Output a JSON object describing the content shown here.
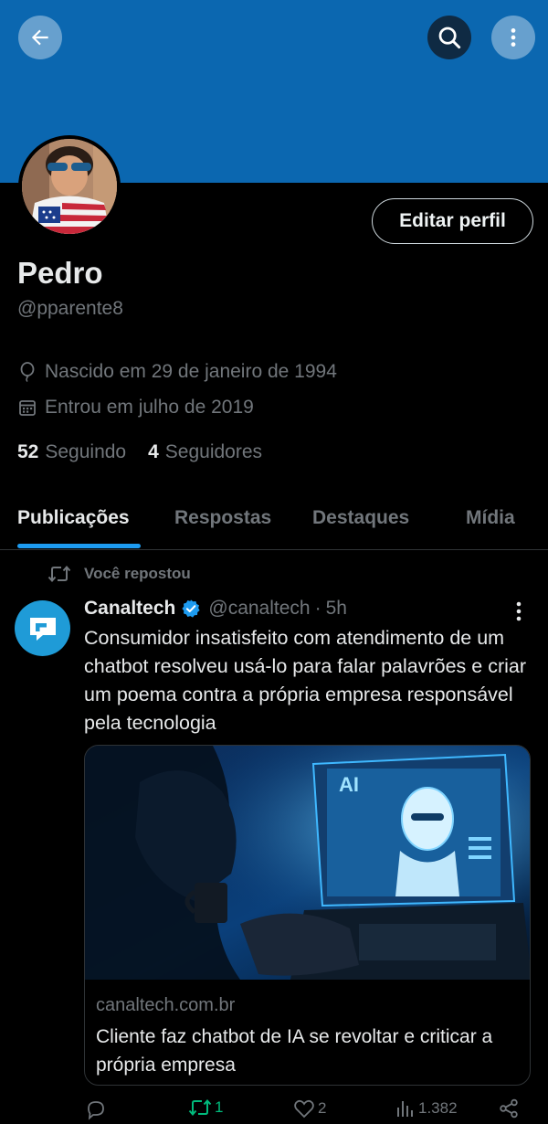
{
  "header": {
    "back_icon": "arrow-left-icon",
    "search_icon": "search-icon",
    "more_icon": "more-vertical-icon",
    "banner_color": "#0b67b0"
  },
  "profile": {
    "name": "Pedro",
    "handle": "@pparente8",
    "edit_button": "Editar perfil",
    "birth": "Nascido em 29 de janeiro de 1994",
    "joined": "Entrou em julho de 2019",
    "following_count": "52",
    "following_label": "Seguindo",
    "followers_count": "4",
    "followers_label": "Seguidores"
  },
  "tabs": [
    {
      "label": "Publicações",
      "active": true
    },
    {
      "label": "Respostas",
      "active": false
    },
    {
      "label": "Destaques",
      "active": false
    },
    {
      "label": "Mídia",
      "active": false
    }
  ],
  "post": {
    "repost_label": "Você repostou",
    "author": "Canaltech",
    "handle": "@canaltech",
    "separator": "·",
    "time": "5h",
    "text": "Consumidor insatisfeito com atendimento de um chatbot resolveu usá-lo para falar palavrões e criar um poema contra a própria empresa responsável pela tecnologia",
    "card": {
      "domain": "canaltech.com.br",
      "title": "Cliente faz chatbot de IA se revoltar e criticar a própria empresa",
      "image_label": "AI"
    },
    "actions": {
      "reply_count": "",
      "repost_count": "1",
      "like_count": "2",
      "views_count": "1.382"
    }
  },
  "colors": {
    "accent": "#1d9bf0",
    "repost_green": "#00ba7c",
    "muted": "#71767b"
  }
}
